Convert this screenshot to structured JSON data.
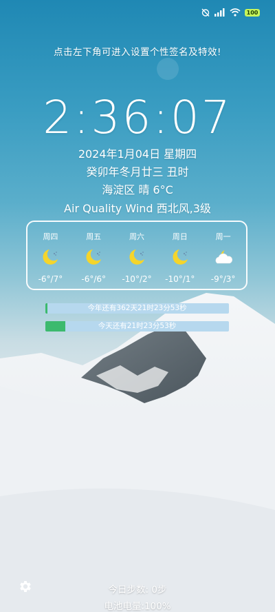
{
  "status_bar": {
    "battery_level": "100",
    "icons": [
      "alarm-off-icon",
      "signal-icon",
      "wifi-icon",
      "battery-icon"
    ]
  },
  "hint": "点击左下角可进入设置个性签名及特效!",
  "clock": "2:36:07",
  "date_line": "2024年1月04日  星期四",
  "lunar_line": "癸卯年冬月廿三  丑时",
  "weather_line": "海淀区   晴   6°C",
  "air_line": "Air Quality  Wind 西北风,3级",
  "forecast": [
    {
      "day": "周四",
      "icon": "moon-cloud-icon",
      "temp": "-6°/7°"
    },
    {
      "day": "周五",
      "icon": "moon-cloud-icon",
      "temp": "-6°/6°"
    },
    {
      "day": "周六",
      "icon": "moon-cloud-icon",
      "temp": "-10°/2°"
    },
    {
      "day": "周日",
      "icon": "moon-cloud-icon",
      "temp": "-10°/1°"
    },
    {
      "day": "周一",
      "icon": "cloudy-moon-icon",
      "temp": "-9°/3°"
    }
  ],
  "year_progress": {
    "label": "今年还有362天21时23分53秒",
    "fraction": 0.011
  },
  "day_progress": {
    "label": "今天还有21时23分53秒",
    "fraction": 0.108
  },
  "steps": "今日步数:  0步",
  "battery_text": "电池电量:100%",
  "colors": {
    "progress_fill": "#3cba6e",
    "progress_track": "#b6d8ee",
    "battery_badge": "#c7f55a"
  }
}
